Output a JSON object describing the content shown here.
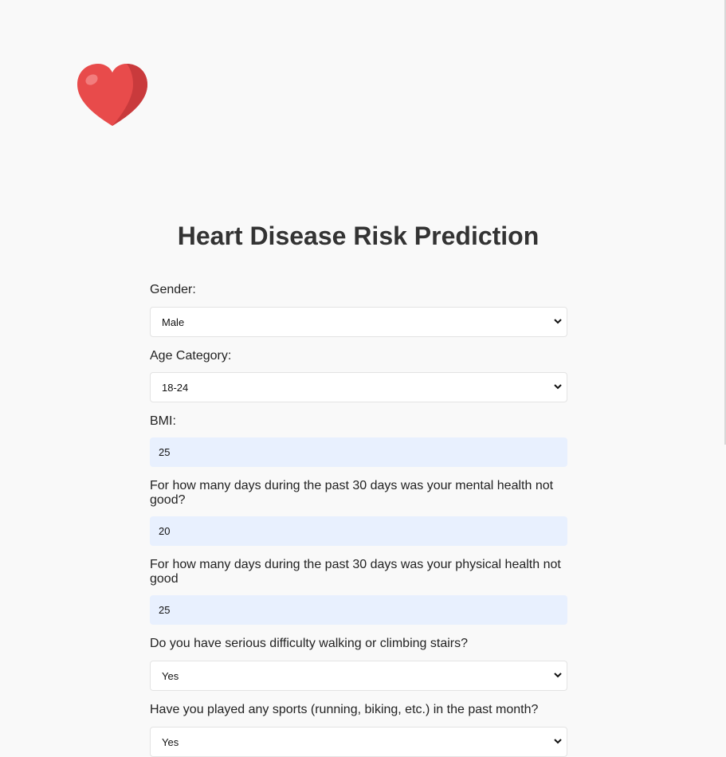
{
  "header": {
    "logo_icon": "heart-icon",
    "title": "Heart Disease Risk Prediction"
  },
  "form": {
    "gender": {
      "label": "Gender:",
      "value": "Male"
    },
    "age": {
      "label": "Age Category:",
      "value": "18-24"
    },
    "bmi": {
      "label": "BMI:",
      "value": "25"
    },
    "mental": {
      "label": "For how many days during the past 30 days was your mental health not good?",
      "value": "20"
    },
    "physical": {
      "label": "For how many days during the past 30 days was your physical health not good",
      "value": "25"
    },
    "walking": {
      "label": "Do you have serious difficulty walking or climbing stairs?",
      "value": "Yes"
    },
    "sports": {
      "label": "Have you played any sports (running, biking, etc.) in the past month?",
      "value": "Yes"
    }
  },
  "colors": {
    "heart": "#e84b4b",
    "input_autofill": "#e8f0fe",
    "background": "#f9f9f9"
  }
}
